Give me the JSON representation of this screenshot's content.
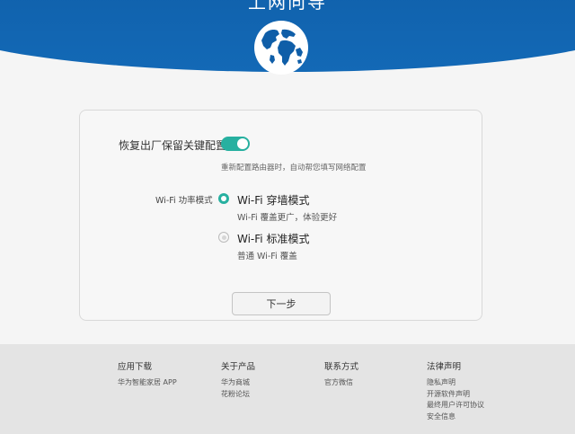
{
  "header": {
    "title": "上网向导",
    "globe_icon": "globe-icon"
  },
  "colors": {
    "header_blue": "#0f5ea8",
    "accent_teal": "#27b0a0",
    "footer_bg": "#e4e4e4"
  },
  "settings": {
    "reset_label": "恢复出厂保留关键配置",
    "reset_enabled": true,
    "reset_description": "重新配置路由器时，自动帮您填写网络配置",
    "power_mode_label": "Wi-Fi 功率模式",
    "options": [
      {
        "title": "Wi-Fi 穿墙模式",
        "description": "Wi-Fi 覆盖更广，体验更好",
        "selected": true
      },
      {
        "title": "Wi-Fi 标准模式",
        "description": "普通 Wi-Fi 覆盖",
        "selected": false
      }
    ],
    "next_button": "下一步"
  },
  "footer": {
    "columns": [
      {
        "heading": "应用下载",
        "links": [
          "华为智能家居 APP"
        ]
      },
      {
        "heading": "关于产品",
        "links": [
          "华为商城",
          "花粉论坛"
        ]
      },
      {
        "heading": "联系方式",
        "links": [
          "官方微信"
        ]
      },
      {
        "heading": "法律声明",
        "links": [
          "隐私声明",
          "开源软件声明",
          "最终用户许可协议",
          "安全信息"
        ]
      }
    ]
  }
}
